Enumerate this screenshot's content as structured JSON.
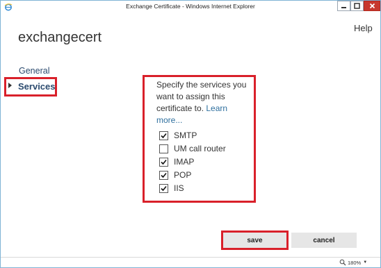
{
  "window": {
    "title": "Exchange Certificate - Windows Internet Explorer",
    "zoom": "180%"
  },
  "header": {
    "help": "Help",
    "page_title": "exchangecert"
  },
  "nav": {
    "items": [
      {
        "label": "General",
        "selected": false
      },
      {
        "label": "Services",
        "selected": true
      }
    ]
  },
  "services": {
    "description_text": "Specify the services you want to assign this certificate to. ",
    "learn_more": "Learn more...",
    "options": [
      {
        "label": "SMTP",
        "checked": true
      },
      {
        "label": "UM call router",
        "checked": false
      },
      {
        "label": "IMAP",
        "checked": true
      },
      {
        "label": "POP",
        "checked": true
      },
      {
        "label": "IIS",
        "checked": true
      }
    ]
  },
  "actions": {
    "save_label": "save",
    "cancel_label": "cancel"
  },
  "colors": {
    "highlight": "#d9202a",
    "nav_text": "#2b4a6e",
    "link": "#2e6f9e",
    "button_bg": "#e6e6e6"
  }
}
